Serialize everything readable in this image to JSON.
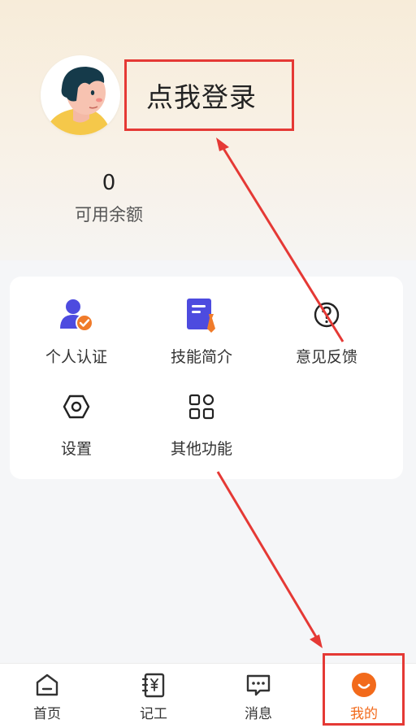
{
  "profile": {
    "login_label": "点我登录",
    "balance_value": "0",
    "balance_label": "可用余额"
  },
  "menu": {
    "items": [
      {
        "label": "个人认证",
        "icon": "verified-user-icon"
      },
      {
        "label": "技能简介",
        "icon": "skill-doc-icon"
      },
      {
        "label": "意见反馈",
        "icon": "question-icon"
      },
      {
        "label": "设置",
        "icon": "settings-hex-icon"
      },
      {
        "label": "其他功能",
        "icon": "grid-apps-icon"
      }
    ]
  },
  "tabbar": {
    "items": [
      {
        "label": "首页",
        "icon": "home-icon"
      },
      {
        "label": "记工",
        "icon": "ledger-yen-icon"
      },
      {
        "label": "消息",
        "icon": "message-icon"
      },
      {
        "label": "我的",
        "icon": "me-smile-icon",
        "active": true
      }
    ]
  },
  "colors": {
    "accent": "#f26a1b",
    "icon_purple": "#4d4bdf",
    "annotation_red": "#e53935"
  }
}
